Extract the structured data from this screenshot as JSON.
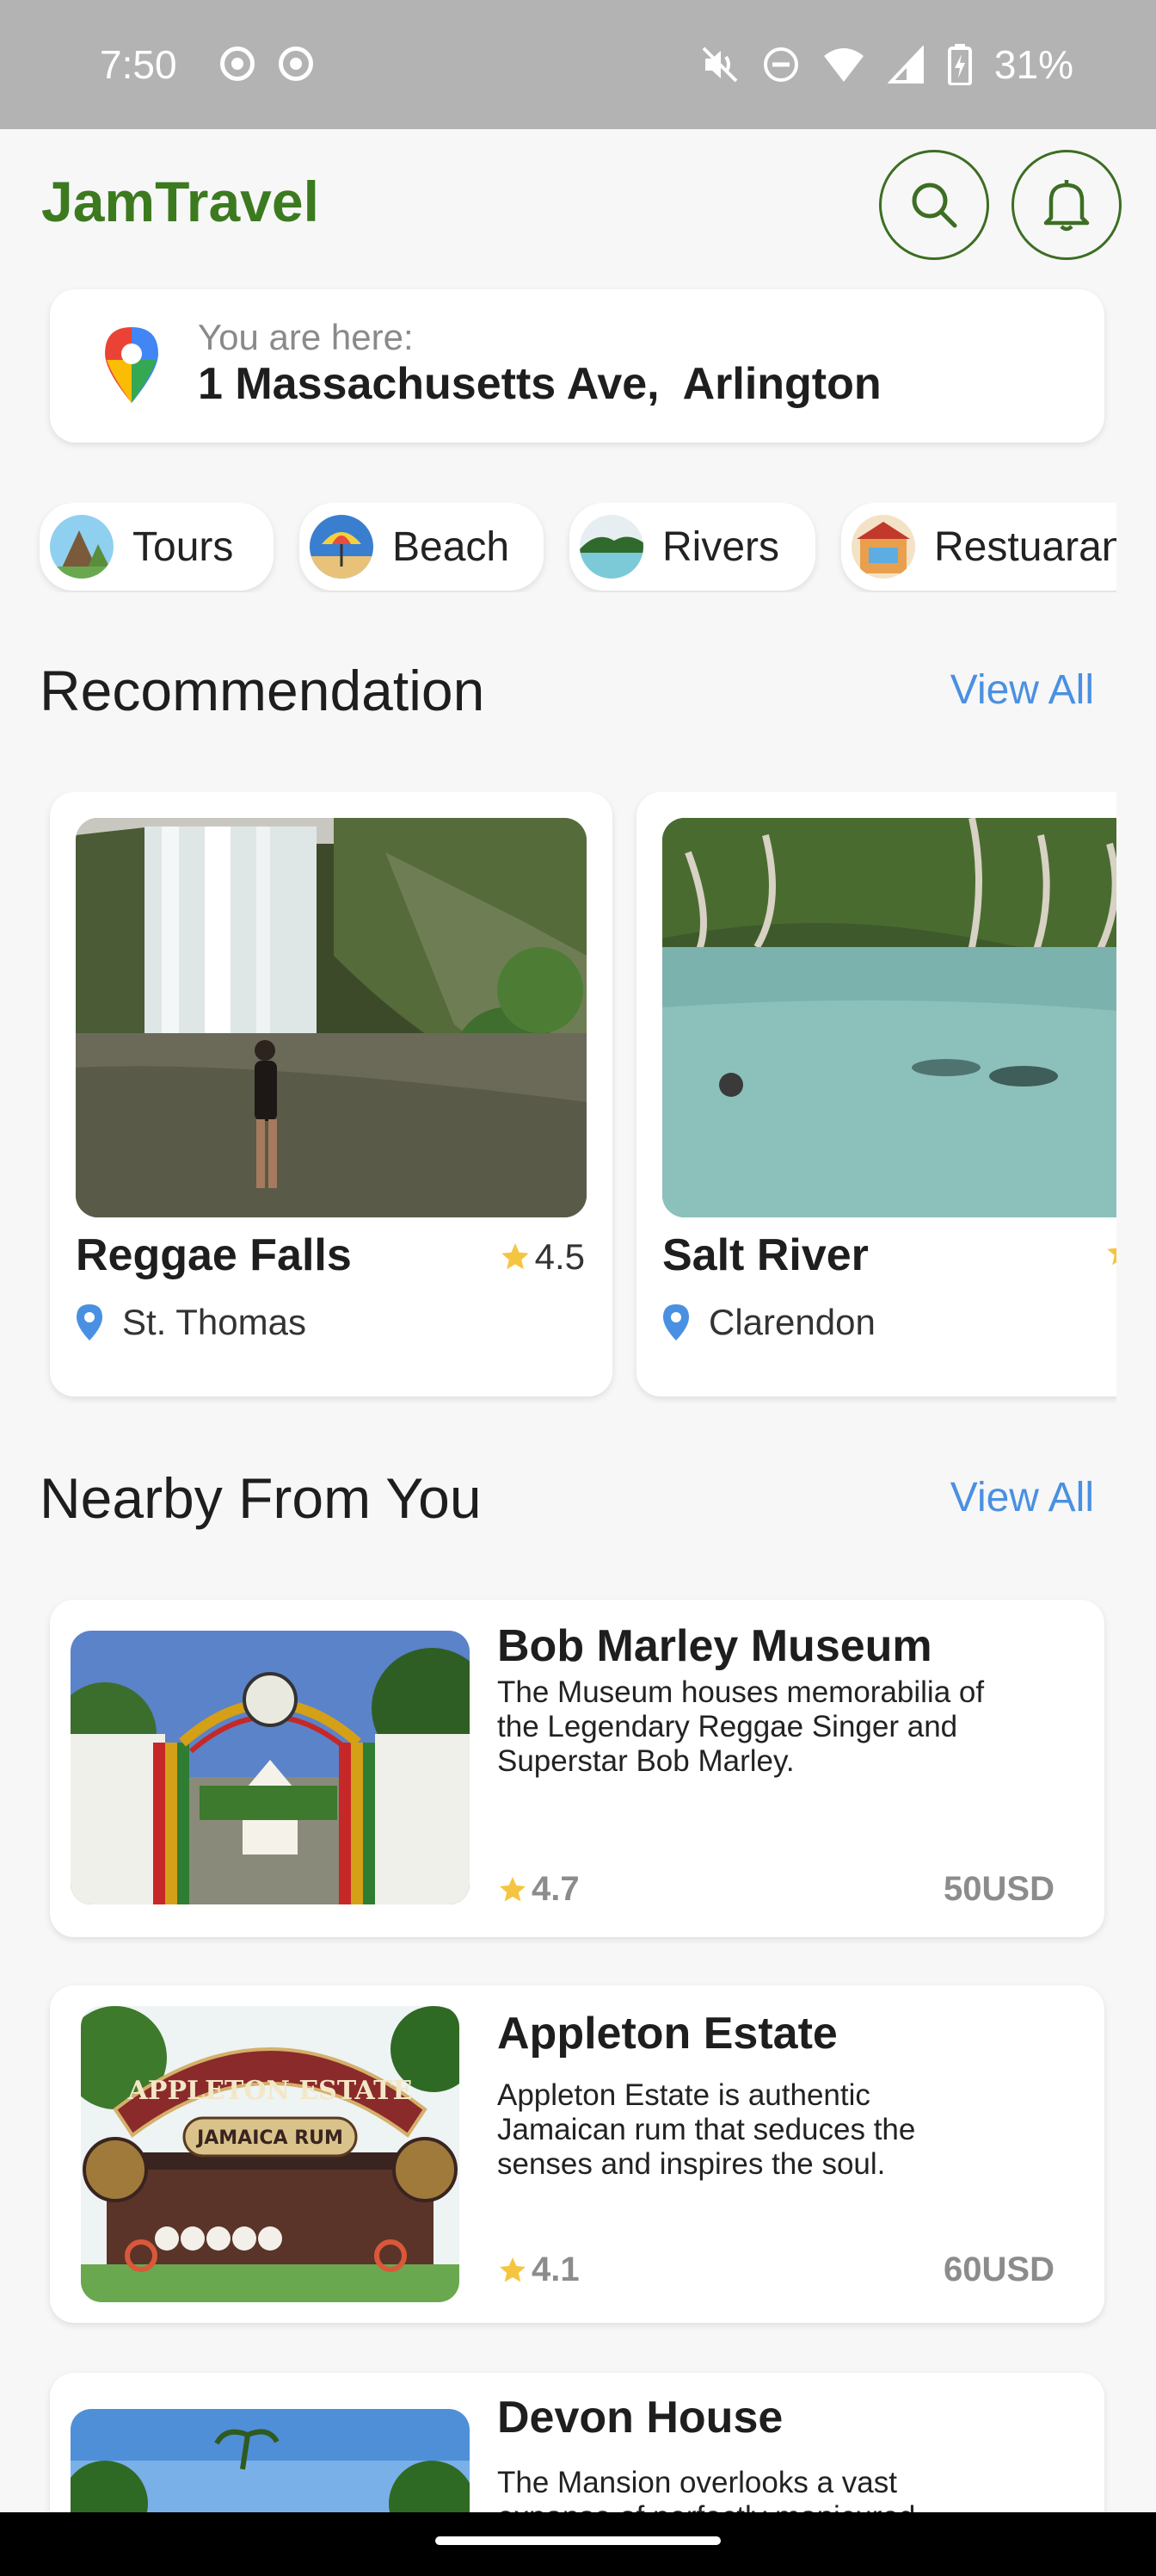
{
  "status_bar": {
    "time": "7:50",
    "battery": "31%"
  },
  "header": {
    "app_title": "JamTravel",
    "search_icon": "search-icon",
    "bell_icon": "bell-icon"
  },
  "location": {
    "label": "You are here:",
    "address": "1 Massachusetts Ave,  Arlington"
  },
  "categories": [
    {
      "label": "Tours"
    },
    {
      "label": "Beach"
    },
    {
      "label": "Rivers"
    },
    {
      "label": "Restuarants"
    }
  ],
  "recommendation": {
    "title": "Recommendation",
    "view_all": "View All",
    "items": [
      {
        "name": "Reggae Falls",
        "rating": "4.5",
        "location": "St. Thomas"
      },
      {
        "name": "Salt River",
        "rating": "",
        "location": "Clarendon"
      }
    ]
  },
  "nearby": {
    "title": "Nearby From You",
    "view_all": "View All",
    "items": [
      {
        "name": "Bob Marley Museum",
        "description": "The Museum houses memorabilia of the Legendary Reggae Singer and Superstar Bob Marley.",
        "rating": "4.7",
        "price": "50USD"
      },
      {
        "name": "Appleton Estate",
        "description": "Appleton Estate is authentic Jamaican rum that seduces the senses and inspires the soul.",
        "rating": "4.1",
        "price": "60USD"
      },
      {
        "name": "Devon House",
        "description": "The Mansion overlooks a vast expanse of perfectly manicured",
        "rating": "",
        "price": ""
      }
    ]
  },
  "image_text": {
    "appleton_sign": "APPLETON ESTATE",
    "appleton_sub": "JAMAICA RUM"
  },
  "colors": {
    "brand_green": "#3c7a1f",
    "link_blue": "#4a90e2",
    "star_yellow": "#f5c542"
  }
}
